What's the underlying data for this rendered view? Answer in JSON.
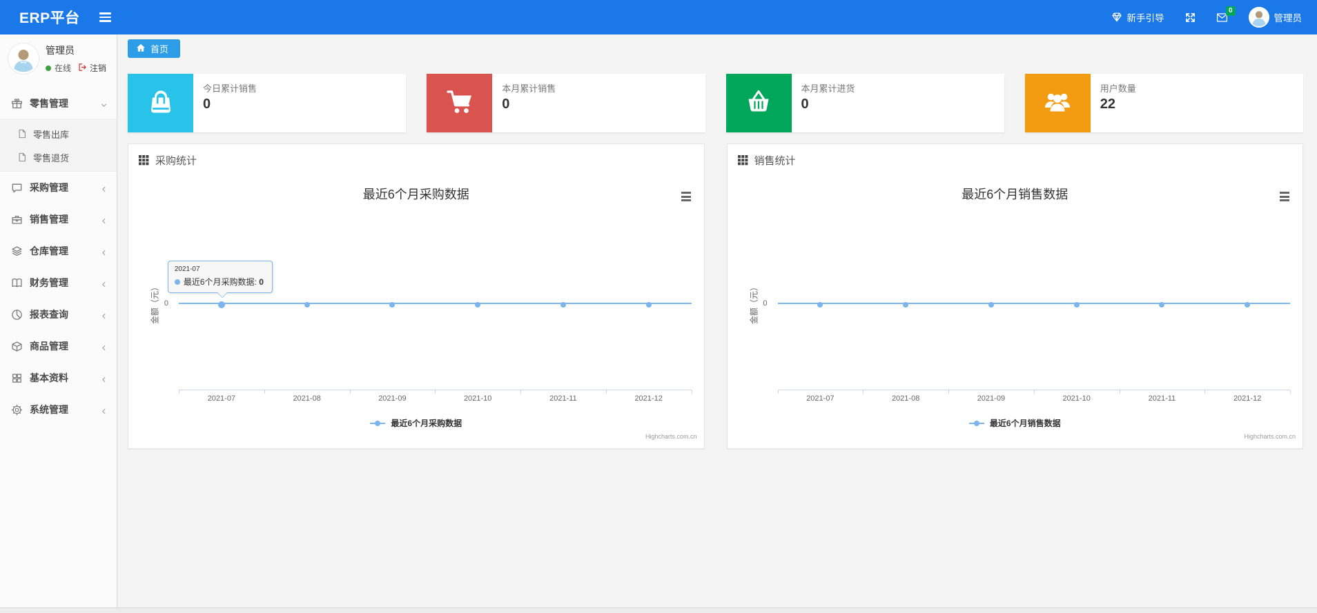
{
  "colors": {
    "navbar": "#1b78e8",
    "breadcrumb_tab": "#2d9de8",
    "badge": "#00a65a",
    "series": "#7cb5ec",
    "online_dot": "#3c9f40"
  },
  "navbar": {
    "brand": "ERP平台",
    "guide_label": "新手引导",
    "badge_count": "0",
    "username": "管理员"
  },
  "sidebar": {
    "user": {
      "name": "管理员",
      "status": "在线",
      "logout": "注销"
    },
    "menu": [
      {
        "key": "retail",
        "label": "零售管理",
        "icon": "gift-icon",
        "expanded": true,
        "children": [
          {
            "key": "retail-outbound",
            "label": "零售出库",
            "icon": "file-icon"
          },
          {
            "key": "retail-return",
            "label": "零售退货",
            "icon": "file-icon"
          }
        ]
      },
      {
        "key": "purchase",
        "label": "采购管理",
        "icon": "comment-icon"
      },
      {
        "key": "sales",
        "label": "销售管理",
        "icon": "briefcase-icon"
      },
      {
        "key": "warehouse",
        "label": "仓库管理",
        "icon": "layers-icon"
      },
      {
        "key": "finance",
        "label": "财务管理",
        "icon": "book-icon"
      },
      {
        "key": "reports",
        "label": "报表查询",
        "icon": "pie-chart-icon"
      },
      {
        "key": "goods",
        "label": "商品管理",
        "icon": "cube-icon"
      },
      {
        "key": "basic-data",
        "label": "基本资料",
        "icon": "grid-icon"
      },
      {
        "key": "system",
        "label": "系统管理",
        "icon": "gear-icon"
      }
    ]
  },
  "breadcrumb": {
    "home": "首页"
  },
  "stat_cards": [
    {
      "key": "today-sales",
      "label": "今日累计销售",
      "value": "0",
      "color": "#29c2e8",
      "icon": "shopping-bag-icon"
    },
    {
      "key": "month-sales",
      "label": "本月累计销售",
      "value": "0",
      "color": "#d9534f",
      "icon": "cart-icon"
    },
    {
      "key": "month-purchase",
      "label": "本月累计进货",
      "value": "0",
      "color": "#00a65a",
      "icon": "basket-icon"
    },
    {
      "key": "user-count",
      "label": "用户数量",
      "value": "22",
      "color": "#f39c12",
      "icon": "users-icon"
    }
  ],
  "panels": [
    {
      "key": "purchase-stats",
      "header": "采购统计"
    },
    {
      "key": "sales-stats",
      "header": "销售统计"
    }
  ],
  "chart_data": [
    {
      "type": "line",
      "title": "最近6个月采购数据",
      "categories": [
        "2021-07",
        "2021-08",
        "2021-09",
        "2021-10",
        "2021-11",
        "2021-12"
      ],
      "series": [
        {
          "name": "最近6个月采购数据",
          "values": [
            0,
            0,
            0,
            0,
            0,
            0
          ]
        }
      ],
      "ylabel": "金额（元）",
      "yticks": [
        "0"
      ],
      "ylim": [
        -1,
        1
      ],
      "grid": false,
      "legend_position": "bottom",
      "color": "#7cb5ec",
      "credits": "Highcharts.com.cn",
      "tooltip": {
        "visible": true,
        "point_index": 0,
        "header": "2021-07",
        "series_label": "最近6个月采购数据",
        "value": "0"
      }
    },
    {
      "type": "line",
      "title": "最近6个月销售数据",
      "categories": [
        "2021-07",
        "2021-08",
        "2021-09",
        "2021-10",
        "2021-11",
        "2021-12"
      ],
      "series": [
        {
          "name": "最近6个月销售数据",
          "values": [
            0,
            0,
            0,
            0,
            0,
            0
          ]
        }
      ],
      "ylabel": "金额（元）",
      "yticks": [
        "0"
      ],
      "ylim": [
        -1,
        1
      ],
      "grid": false,
      "legend_position": "bottom",
      "color": "#7cb5ec",
      "credits": "Highcharts.com.cn",
      "tooltip": {
        "visible": false
      }
    }
  ]
}
